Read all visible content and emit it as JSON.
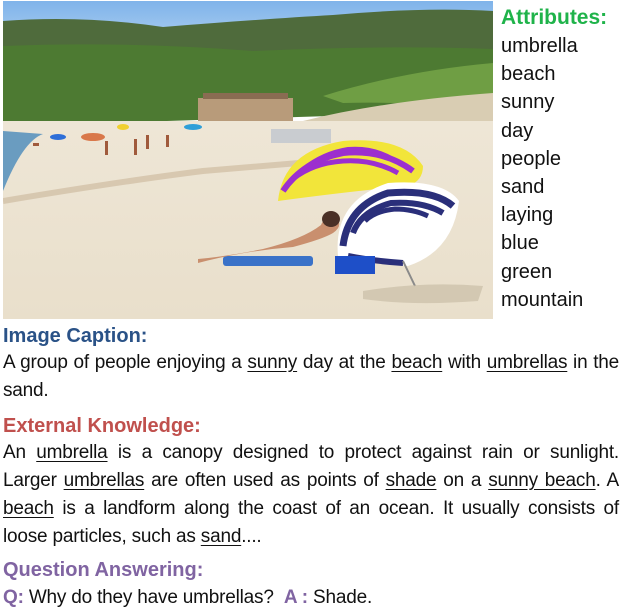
{
  "figure": {
    "image_alt": "Beach scene with people and striped umbrellas in front of green mountains",
    "attributes": {
      "title": "Attributes:",
      "items": [
        "umbrella",
        "beach",
        "sunny",
        "day",
        "people",
        "sand",
        "laying",
        "blue",
        "green",
        "mountain"
      ]
    },
    "caption": {
      "title": "Image Caption:",
      "segments": [
        {
          "text": "A group of people enjoying a ",
          "u": false
        },
        {
          "text": "sunny",
          "u": true
        },
        {
          "text": " day at the ",
          "u": false
        },
        {
          "text": "beach",
          "u": true
        },
        {
          "text": " with ",
          "u": false
        },
        {
          "text": "umbrellas",
          "u": true
        },
        {
          "text": " in the sand.",
          "u": false
        }
      ]
    },
    "knowledge": {
      "title": "External Knowledge:",
      "segments": [
        {
          "text": "An ",
          "u": false
        },
        {
          "text": "umbrella",
          "u": true
        },
        {
          "text": " is a canopy designed to protect against rain or sunlight. Larger ",
          "u": false
        },
        {
          "text": "umbrellas",
          "u": true
        },
        {
          "text": " are often used as points of ",
          "u": false
        },
        {
          "text": "shade",
          "u": true
        },
        {
          "text": " on a ",
          "u": false
        },
        {
          "text": "sunny beach",
          "u": true
        },
        {
          "text": ". A ",
          "u": false
        },
        {
          "text": "beach",
          "u": true
        },
        {
          "text": " is a landform along the coast of an ocean. It usually consists of loose particles, such as ",
          "u": false
        },
        {
          "text": "sand",
          "u": true
        },
        {
          "text": "....",
          "u": false
        }
      ]
    },
    "qa": {
      "title": "Question Answering:",
      "q_label": "Q:",
      "question": "Why do they have umbrellas?",
      "a_label": "A :",
      "answer": "Shade."
    },
    "colors": {
      "attributes_title": "#1fb34a",
      "caption_title": "#2a5287",
      "knowledge_title": "#c0504d",
      "qa_title": "#8064a2"
    }
  }
}
